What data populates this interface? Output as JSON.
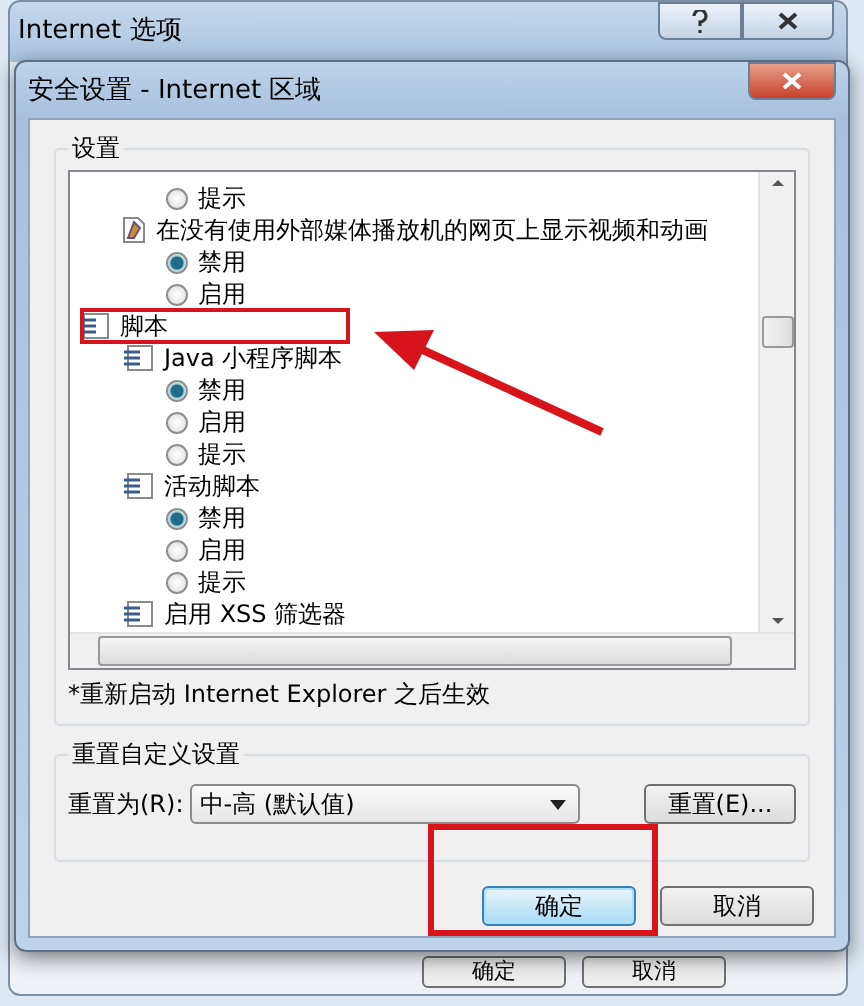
{
  "outer_window": {
    "title": "Internet 选项",
    "buttons": [
      "确定",
      "取消"
    ]
  },
  "dialog": {
    "title": "安全设置 - Internet 区域",
    "settings": {
      "heading": "设置",
      "tree": [
        {
          "kind": "continued",
          "children": [
            {
              "kind": "continued",
              "options": [
                {
                  "label": "提示",
                  "selected": false
                }
              ]
            },
            {
              "kind": "media_setting",
              "label": "在没有使用外部媒体播放机的网页上显示视频和动画",
              "options": [
                {
                  "label": "禁用",
                  "selected": true
                },
                {
                  "label": "启用",
                  "selected": false
                }
              ]
            }
          ]
        },
        {
          "kind": "group",
          "label": "脚本",
          "children": [
            {
              "kind": "script_setting",
              "label": "Java 小程序脚本",
              "options": [
                {
                  "label": "禁用",
                  "selected": true
                },
                {
                  "label": "启用",
                  "selected": false
                },
                {
                  "label": "提示",
                  "selected": false
                }
              ]
            },
            {
              "kind": "script_setting",
              "label": "活动脚本",
              "options": [
                {
                  "label": "禁用",
                  "selected": true
                },
                {
                  "label": "启用",
                  "selected": false
                },
                {
                  "label": "提示",
                  "selected": false
                }
              ]
            },
            {
              "kind": "script_setting",
              "label": "启用 XSS 筛选器"
            }
          ]
        }
      ],
      "note": "*重新启动 Internet Explorer 之后生效"
    },
    "reset": {
      "heading": "重置自定义设置",
      "label": "重置为(R):",
      "value": "中-高 (默认值)",
      "button": "重置(E)..."
    },
    "buttons": [
      {
        "label": "确定",
        "default": true
      },
      {
        "label": "取消",
        "default": false
      }
    ]
  }
}
